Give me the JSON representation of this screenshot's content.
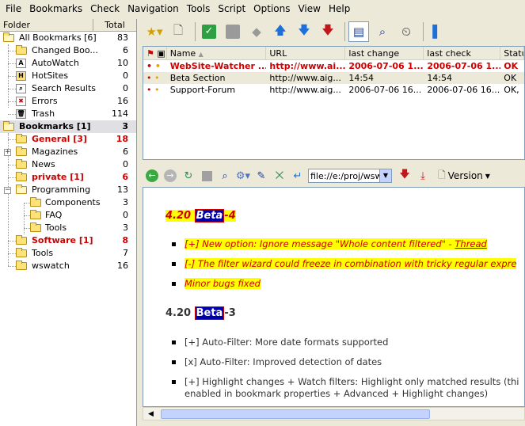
{
  "menu": [
    "File",
    "Bookmarks",
    "Check",
    "Navigation",
    "Tools",
    "Script",
    "Options",
    "View",
    "Help"
  ],
  "folder_pane": {
    "col_folder": "Folder",
    "col_total": "Total",
    "items": [
      {
        "label": "All Bookmarks  [6]",
        "count": "83"
      },
      {
        "label": "Changed Boo...",
        "count": "6"
      },
      {
        "label": "AutoWatch",
        "count": "10"
      },
      {
        "label": "HotSites",
        "count": "0"
      },
      {
        "label": "Search Results",
        "count": "0"
      },
      {
        "label": "Errors",
        "count": "16"
      },
      {
        "label": "Trash",
        "count": "114"
      },
      {
        "label": "Bookmarks  [1]",
        "count": "3"
      },
      {
        "label": "General  [3]",
        "count": "18"
      },
      {
        "label": "Magazines",
        "count": "6"
      },
      {
        "label": "News",
        "count": "0"
      },
      {
        "label": "private  [1]",
        "count": "6"
      },
      {
        "label": "Programming",
        "count": "13"
      },
      {
        "label": "Components",
        "count": "3"
      },
      {
        "label": "FAQ",
        "count": "0"
      },
      {
        "label": "Tools",
        "count": "3"
      },
      {
        "label": "Software  [1]",
        "count": "8"
      },
      {
        "label": "Tools",
        "count": "7"
      },
      {
        "label": "wswatch",
        "count": "16"
      }
    ]
  },
  "bookmark_list": {
    "columns": [
      "Name",
      "URL",
      "last change",
      "last check",
      "Statu"
    ],
    "rows": [
      {
        "name": "WebSite-Watcher ...",
        "url": "http://www.ai...",
        "last_change": "2006-07-06  1...",
        "last_check": "2006-07-06  1...",
        "status": "OK"
      },
      {
        "name": "Beta Section",
        "url": "http://www.aig...",
        "last_change": "14:54",
        "last_check": "14:54",
        "status": "OK"
      },
      {
        "name": "Support-Forum",
        "url": "http://www.aig...",
        "last_change": "2006-07-06  16...",
        "last_check": "2006-07-06  16...",
        "status": "OK,"
      }
    ]
  },
  "browser": {
    "address": "file://e:/proj/wsw...",
    "version_label": "Version"
  },
  "content": {
    "h1_prefix": "4.20 ",
    "h1_beta": "Beta",
    "h1_suffix": "-4",
    "h1_items": [
      {
        "text": "[+] New option: Ignore message \"Whole content filtered\" - ",
        "link": "Thread"
      },
      {
        "text": "[-] The filter wizard could freeze in combination with tricky regular expre"
      },
      {
        "text": "Minor bugs fixed"
      }
    ],
    "h2_prefix": "4.20 ",
    "h2_beta": "Beta",
    "h2_suffix": "-3",
    "h2_items": [
      "[+] Auto-Filter: More date formats supported",
      "[x] Auto-Filter: Improved detection of dates",
      "[+] Highlight changes + Watch filters: Highlight only matched results (thi",
      "enabled in bookmark properties + Advanced + Highlight changes)"
    ]
  }
}
